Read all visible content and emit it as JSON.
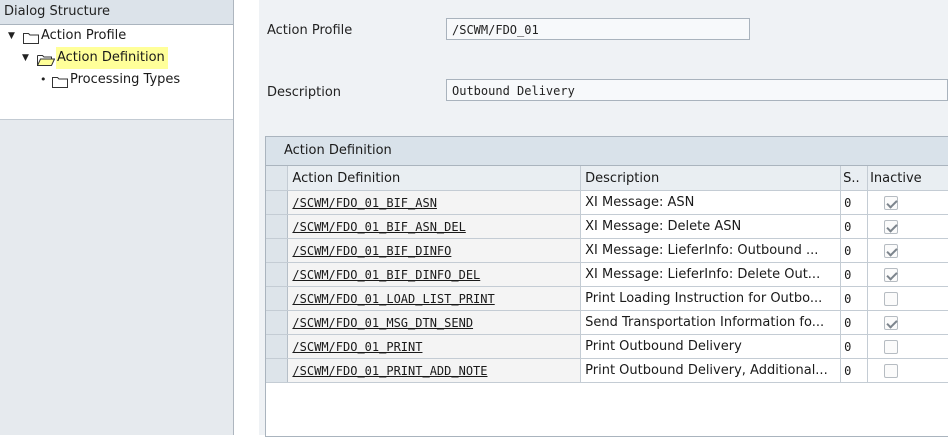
{
  "dialog_structure": {
    "header": "Dialog Structure",
    "items": [
      {
        "label": "Action Profile",
        "expanded": true
      },
      {
        "label": "Action Definition",
        "expanded": true,
        "selected": true
      },
      {
        "label": "Processing Types",
        "expanded": false
      }
    ]
  },
  "form": {
    "profile_label": "Action Profile",
    "profile_value": "/SCWM/FDO_01",
    "description_label": "Description",
    "description_value": "Outbound Delivery"
  },
  "table": {
    "title": "Action Definition",
    "columns": [
      "Action Definition",
      "Description",
      "S..",
      "Inactive"
    ],
    "rows": [
      {
        "code": "/SCWM/FDO_01_BIF_ASN",
        "desc": "XI Message: ASN",
        "s": "0",
        "inactive": true
      },
      {
        "code": "/SCWM/FDO_01_BIF_ASN_DEL",
        "desc": "XI Message: Delete ASN",
        "s": "0",
        "inactive": true
      },
      {
        "code": "/SCWM/FDO_01_BIF_DINFO",
        "desc": "XI Message: LieferInfo: Outbound ...",
        "s": "0",
        "inactive": true
      },
      {
        "code": "/SCWM/FDO_01_BIF_DINFO_DEL",
        "desc": "XI Message: LieferInfo: Delete Out...",
        "s": "0",
        "inactive": true
      },
      {
        "code": "/SCWM/FDO_01_LOAD_LIST_PRINT",
        "desc": "Print Loading Instruction for Outbo...",
        "s": "0",
        "inactive": false
      },
      {
        "code": "/SCWM/FDO_01_MSG_DTN_SEND",
        "desc": "Send Transportation Information fo...",
        "s": "0",
        "inactive": true
      },
      {
        "code": "/SCWM/FDO_01_PRINT",
        "desc": "Print Outbound Delivery",
        "s": "0",
        "inactive": false
      },
      {
        "code": "/SCWM/FDO_01_PRINT_ADD_NOTE",
        "desc": "Print Outbound Delivery, Additional...",
        "s": "0",
        "inactive": false
      }
    ]
  },
  "icons": {
    "expanded": "triangle-down-icon",
    "leaf": "bullet-icon",
    "folder": "folder-icon",
    "open_folder": "open-folder-icon"
  }
}
